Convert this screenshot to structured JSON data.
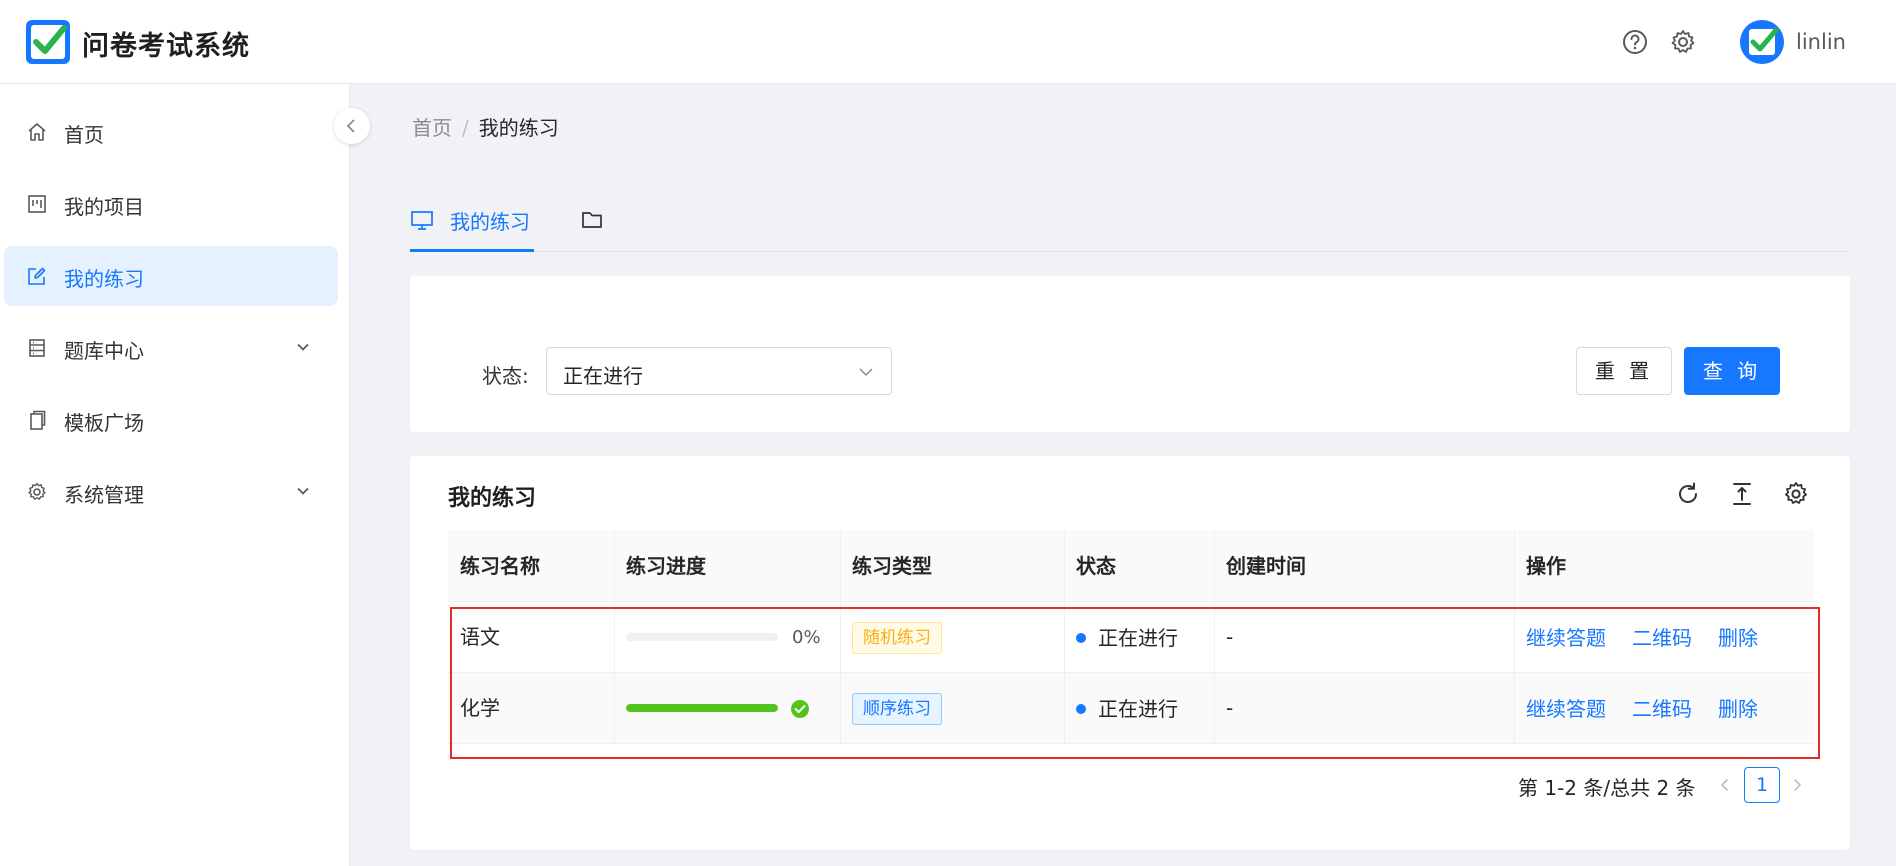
{
  "header": {
    "app_title": "问卷考试系统",
    "username": "linlin"
  },
  "sidebar": {
    "items": [
      {
        "label": "首页",
        "icon": "home-icon"
      },
      {
        "label": "我的项目",
        "icon": "project-icon"
      },
      {
        "label": "我的练习",
        "icon": "edit-icon",
        "active": true
      },
      {
        "label": "题库中心",
        "icon": "database-icon",
        "expandable": true
      },
      {
        "label": "模板广场",
        "icon": "copy-icon"
      },
      {
        "label": "系统管理",
        "icon": "gear-icon",
        "expandable": true
      }
    ]
  },
  "breadcrumb": {
    "home": "首页",
    "separator": "/",
    "current": "我的练习"
  },
  "tabs": {
    "active_label": "我的练习"
  },
  "filter": {
    "status_label": "状态:",
    "status_value": "正在进行",
    "reset_label": "重 置",
    "query_label": "查 询"
  },
  "table": {
    "title": "我的练习",
    "columns": [
      "练习名称",
      "练习进度",
      "练习类型",
      "状态",
      "创建时间",
      "操作"
    ],
    "rows": [
      {
        "name": "语文",
        "progress": 0,
        "progress_text": "0%",
        "type": "随机练习",
        "type_color": "orange",
        "status": "正在进行",
        "created": "-",
        "actions": [
          "继续答题",
          "二维码",
          "删除"
        ]
      },
      {
        "name": "化学",
        "progress": 100,
        "progress_text": "",
        "type": "顺序练习",
        "type_color": "blue",
        "status": "正在进行",
        "created": "-",
        "actions": [
          "继续答题",
          "二维码",
          "删除"
        ]
      }
    ]
  },
  "pagination": {
    "summary": "第 1-2 条/总共 2 条",
    "current_page": "1"
  },
  "colors": {
    "primary": "#1677ff",
    "success": "#52c41a",
    "warning": "#faad14",
    "highlight_box": "#e62b2b"
  }
}
